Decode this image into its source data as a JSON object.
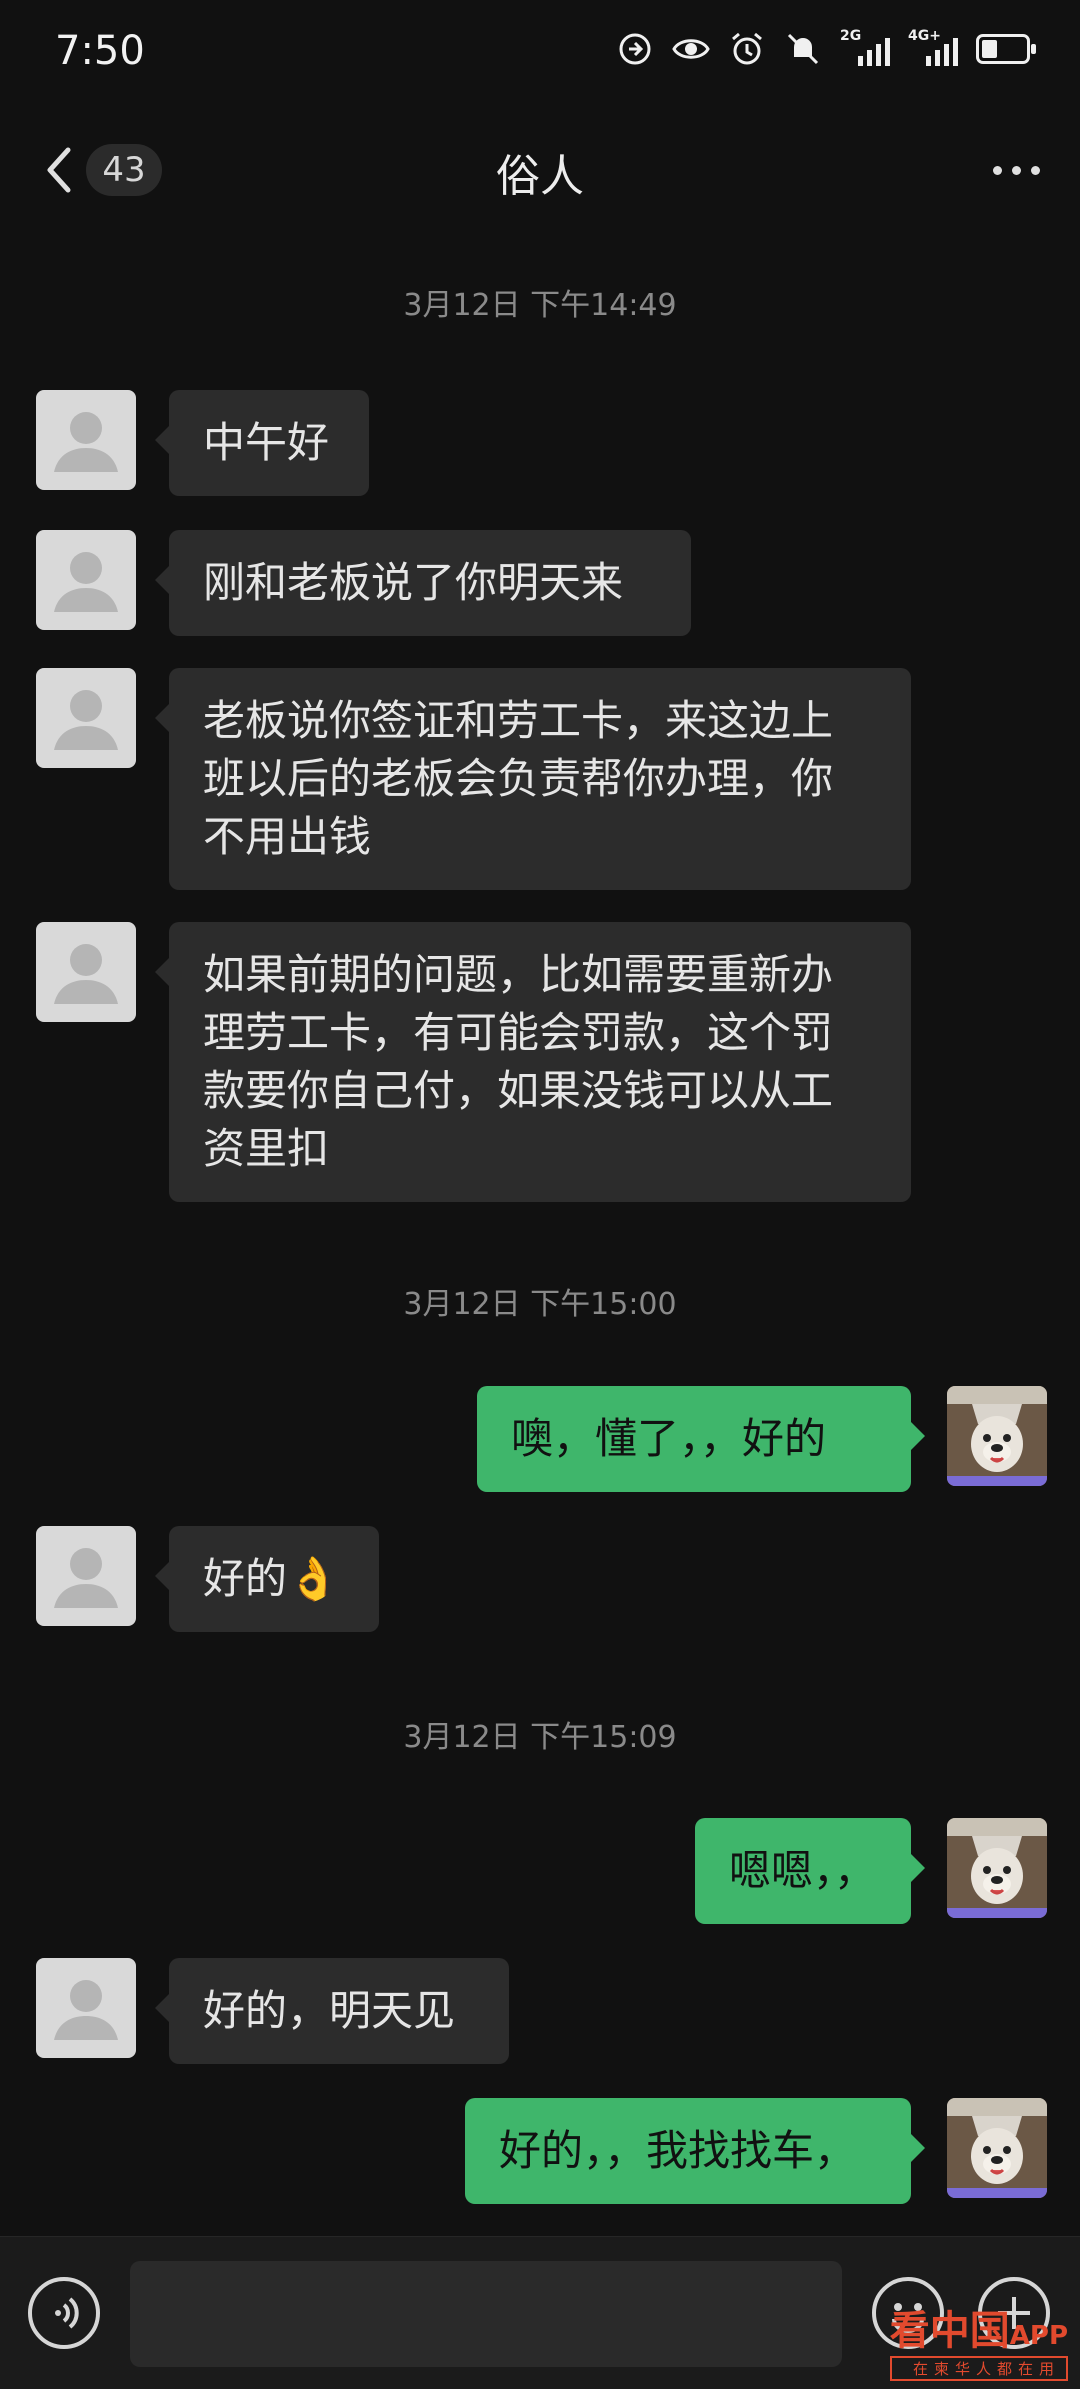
{
  "status_bar": {
    "time": "7:50",
    "network_2g": "2G",
    "network_4g": "4G+",
    "battery_percent": 35,
    "icons": [
      "sync-icon",
      "eye-icon",
      "alarm-icon",
      "mute-icon",
      "signal-icon",
      "signal-icon",
      "battery-icon"
    ]
  },
  "header": {
    "back_icon": "chevron-left-icon",
    "unread_count": "43",
    "title": "俗人",
    "more_icon": "more-dots-icon"
  },
  "timestamps": [
    "3月12日 下午14:49",
    "3月12日 下午15:00",
    "3月12日 下午15:09"
  ],
  "messages": [
    {
      "side": "in",
      "lines": [
        "中午好"
      ]
    },
    {
      "side": "in",
      "lines": [
        "刚和老板说了你明天来"
      ]
    },
    {
      "side": "in",
      "lines": [
        "老板说你签证和劳工卡，来这边上",
        "班以后的老板会负责帮你办理，你",
        "不用出钱"
      ]
    },
    {
      "side": "in",
      "lines": [
        "如果前期的问题，比如需要重新办",
        "理劳工卡，有可能会罚款，这个罚",
        "款要你自己付，如果没钱可以从工",
        "资里扣"
      ]
    },
    {
      "side": "out",
      "lines": [
        "噢，懂了，，好的"
      ]
    },
    {
      "side": "in",
      "lines": [
        "好的👌"
      ]
    },
    {
      "side": "out",
      "lines": [
        "嗯嗯，，"
      ]
    },
    {
      "side": "in",
      "lines": [
        "好的，明天见"
      ]
    },
    {
      "side": "out",
      "lines": [
        "好的，，我找找车，"
      ]
    }
  ],
  "bottom_bar": {
    "voice_icon": "voice-icon",
    "emoji_icon": "emoji-icon",
    "plus_icon": "plus-icon"
  },
  "watermark": {
    "text": "看中国",
    "app": "APP",
    "tagline": "在柬华人都在用"
  },
  "colors": {
    "background": "#111111",
    "incoming_bubble": "#2c2c2c",
    "outgoing_bubble": "#3fb66b",
    "timestamp": "#8a8a8a"
  }
}
